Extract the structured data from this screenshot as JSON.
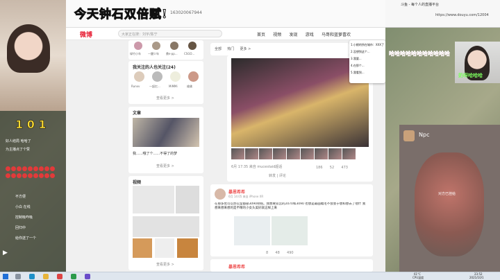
{
  "banner": {
    "text": "今天钟石双倍赋!"
  },
  "browser": {
    "url": "163020067944",
    "logo": "微博",
    "search_placeholder": "大家正在搜：刘宇/陈宁",
    "nav": [
      "首页",
      "视频",
      "发现",
      "游戏",
      "马哥和蓝萝喜欢"
    ],
    "follow_title": "我关注的人也关注(24)",
    "follow_names": [
      "Runxv",
      "一起忆...",
      "MiMMi",
      "维佛"
    ],
    "top_names": [
      "绿竹小车",
      "一醒少年",
      "鼎e·pp...",
      "CSGO..."
    ],
    "more_label": "查看更多 >",
    "article_title": "文章",
    "article_text": "我......哦了个......不得了的梦",
    "video_title": "视频",
    "tabs": [
      "全部",
      "热门",
      "更多 >"
    ],
    "post_time": "6月 17:35 来自 mucestaid超话",
    "post_stats": [
      "186",
      "52",
      "473"
    ],
    "post_meta": "转发 | 评论",
    "post2_user": "暴恩希希",
    "post2_time": "6月 14:05 来自 iPhone XR",
    "post2_text": "在那多优可以办公室都部3090吧呢。我想要双宫的2070和3090 也想是最画幅毛不会会于想和想去了他什 我想来想来想的是不精的小女头美好就这样上来",
    "post2_stats": [
      "8",
      "48",
      "490"
    ],
    "post3_user": "暴恩希希",
    "hot_list": [
      "1.小桃的所在城市：XXX了",
      "2.没想到这个...",
      "3.我要...",
      "4.在那个...",
      "5.我看到..."
    ]
  },
  "right_browser": {
    "url": "https://www.douyu.com/12004",
    "tab_label": "斗鱼 - 每个人的直播平台"
  },
  "overlay": {
    "danmu_top": "哈哈哈哈哈哈哈哈哈哈哈",
    "danmu_right": "奶呀哈哈哈",
    "chat": [
      "好人结局 哈哈了",
      "为主播点了个赞",
      "不方便",
      "小白 在线",
      "控制吸咋吸",
      "回归中",
      "给你送了一个"
    ]
  },
  "chat_window": {
    "name": "Npc",
    "status": "对方已挂给"
  },
  "taskbar": {
    "time": "23:52",
    "date": "2021/10/1",
    "weather": "61°C",
    "cpu": "CPU温度"
  }
}
